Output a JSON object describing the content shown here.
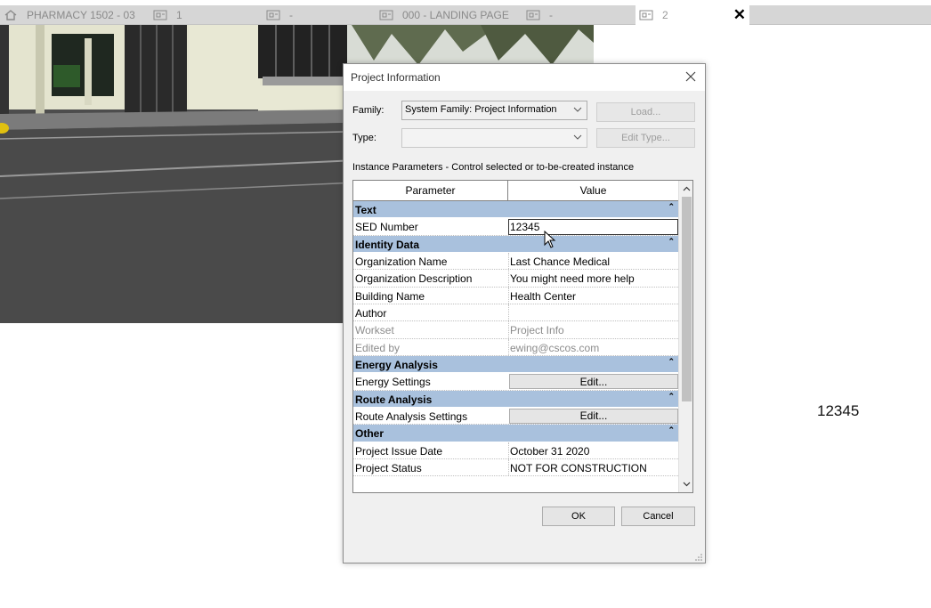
{
  "tabs": [
    {
      "label": "PHARMACY 1502 - 03",
      "icon": "home-icon"
    },
    {
      "label": "1",
      "icon": "sheet-icon"
    },
    {
      "label": "-",
      "icon": "sheet-icon"
    },
    {
      "label": "000 - LANDING PAGE",
      "icon": "sheet-icon"
    },
    {
      "label": "-",
      "icon": "sheet-icon"
    },
    {
      "label": "2",
      "icon": "sheet-icon",
      "active": true
    }
  ],
  "canvas_text": "12345",
  "dialog": {
    "title": "Project Information",
    "family_label": "Family:",
    "family_value": "System Family: Project Information",
    "type_label": "Type:",
    "type_value": "",
    "load_button": "Load...",
    "edit_type_button": "Edit Type...",
    "instance_caption": "Instance Parameters - Control selected or to-be-created instance",
    "grid": {
      "col_parameter": "Parameter",
      "col_value": "Value",
      "groups": {
        "text": "Text",
        "identity": "Identity Data",
        "energy": "Energy Analysis",
        "route": "Route Analysis",
        "other": "Other"
      },
      "rows": {
        "sed_number": {
          "param": "SED Number",
          "value": "12345"
        },
        "org_name": {
          "param": "Organization Name",
          "value": "Last Chance Medical"
        },
        "org_desc": {
          "param": "Organization Description",
          "value": "You might need more help"
        },
        "building": {
          "param": "Building Name",
          "value": "Health Center"
        },
        "author": {
          "param": "Author",
          "value": ""
        },
        "workset": {
          "param": "Workset",
          "value": "Project Info"
        },
        "edited_by": {
          "param": "Edited by",
          "value": "ewing@cscos.com"
        },
        "energy_settings": {
          "param": "Energy Settings",
          "value": "Edit..."
        },
        "route_settings": {
          "param": "Route Analysis Settings",
          "value": "Edit..."
        },
        "issue_date": {
          "param": "Project Issue Date",
          "value": "October 31 2020"
        },
        "status": {
          "param": "Project Status",
          "value": "NOT FOR CONSTRUCTION"
        }
      }
    },
    "ok_button": "OK",
    "cancel_button": "Cancel"
  }
}
